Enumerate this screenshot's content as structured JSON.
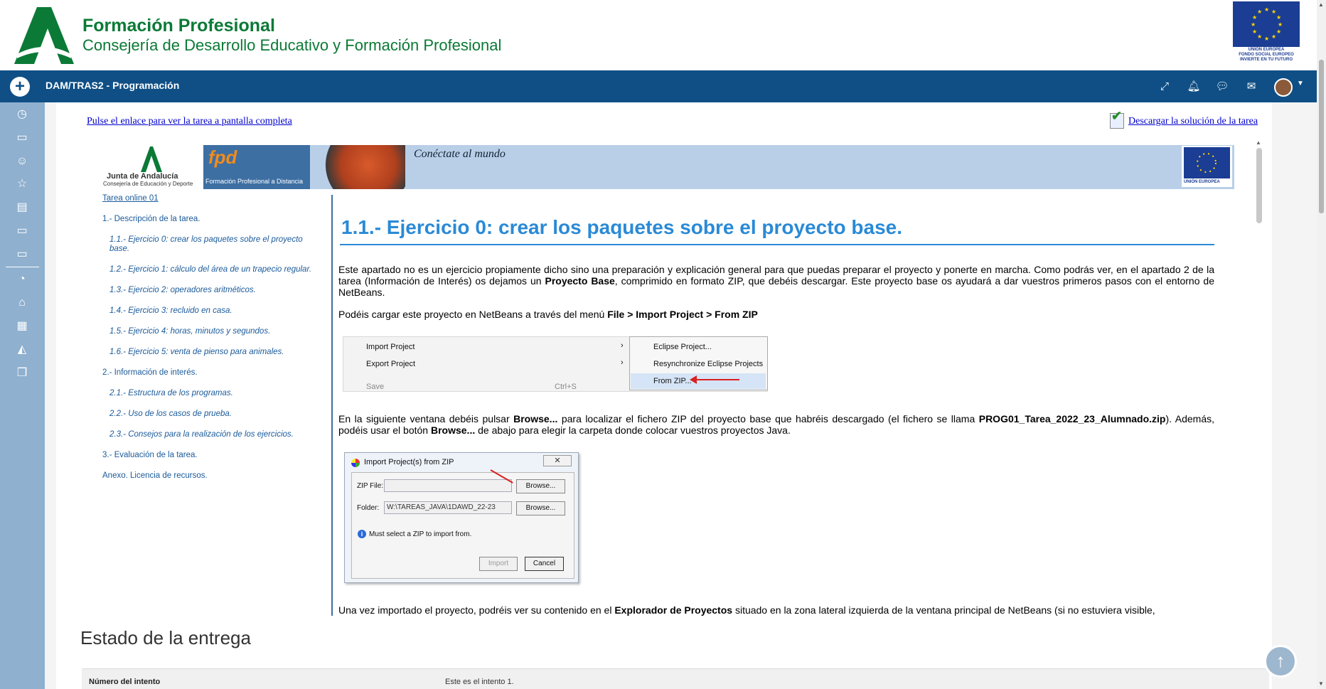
{
  "brand": {
    "title": "Formación Profesional",
    "subtitle": "Consejería de Desarrollo Educativo y Formación Profesional",
    "eu_caption_1": "UNIÓN EUROPEA",
    "eu_caption_2": "FONDO SOCIAL EUROPEO",
    "eu_caption_3": "INVIERTE EN TU FUTURO"
  },
  "navbar": {
    "course_title": "DAM/TRAS2 - Programación",
    "icons": [
      "expand-icon",
      "bell-icon",
      "chat-icon",
      "mail-icon"
    ]
  },
  "sidebar": {
    "icons": [
      "clock-icon",
      "folder-icon",
      "users-icon",
      "star-icon",
      "book-icon",
      "folder-icon",
      "folder-icon",
      "dashboard-icon",
      "home-icon",
      "calendar-icon",
      "graduation-icon",
      "files-icon"
    ]
  },
  "task": {
    "fullscreen_link": "Pulse el enlace para ver la tarea a pantalla completa",
    "download_link": "Descargar la solución de la tarea"
  },
  "banner": {
    "ja_name": "Junta de Andalucía",
    "ja_dept": "Consejería de Educación y Deporte",
    "fpd_logo": "fpd",
    "fpd_caption": "Formación Profesional a Distancia",
    "slogan": "Conéctate al mundo",
    "eu_caption": "UNIÓN EUROPEA"
  },
  "toc": {
    "title": "Tarea online 01",
    "items": [
      "1.- Descripción de la tarea.",
      "1.1.- Ejercicio 0: crear los paquetes sobre el proyecto",
      "base.",
      "1.2.- Ejercicio 1: cálculo del área de un trapecio regular.",
      "1.3.- Ejercicio 2: operadores aritméticos.",
      "1.4.- Ejercicio 3: recluido en casa.",
      "1.5.- Ejercicio 4: horas, minutos y segundos.",
      "1.6.- Ejercicio 5: venta de pienso para animales.",
      "2.- Información de interés.",
      "2.1.- Estructura de los programas.",
      "2.2.- Uso de los casos de prueba.",
      "2.3.- Consejos para la realización de los ejercicios.",
      "3.- Evaluación de la tarea.",
      "Anexo. Licencia de recursos."
    ]
  },
  "content": {
    "heading": "1.1.- Ejercicio 0: crear los paquetes sobre el proyecto base.",
    "p1_a": "Este apartado no es un ejercicio propiamente dicho sino una preparación y explicación general para que puedas preparar el proyecto y ponerte en marcha. Como podrás ver, en el apartado 2 de la tarea (Información de Interés) os dejamos un ",
    "p1_b": "Proyecto Base",
    "p1_c": ", comprimido en formato ZIP, que debéis descargar. Este proyecto base os ayudará a dar vuestros primeros pasos con el entorno de NetBeans.",
    "p2_a": "Podéis cargar este proyecto en NetBeans a través del menú ",
    "p2_b": "File > Import Project > From ZIP",
    "p3_a": "En la siguiente ventana debéis pulsar ",
    "p3_b": "Browse...",
    "p3_c": " para localizar el fichero ZIP del proyecto base que habréis descargado (el fichero se llama ",
    "p3_d": "PROG01_Tarea_2022_23_Alumnado.zip",
    "p3_e": "). Además, podéis usar el botón ",
    "p3_f": "Browse...",
    "p3_g": " de abajo para elegir la carpeta donde colocar vuestros proyectos Java.",
    "p4_a": "Una vez importado el proyecto, podréis ver su contenido en el ",
    "p4_b": "Explorador de Proyectos",
    "p4_c": " situado en la zona lateral izquierda de la ventana principal de NetBeans (si no estuviera visible,"
  },
  "menu_shot": {
    "import_project": "Import Project",
    "export_project": "Export Project",
    "save": "Save",
    "save_shortcut": "Ctrl+S",
    "eclipse_project": "Eclipse Project...",
    "resync": "Resynchronize Eclipse Projects",
    "from_zip": "From ZIP..."
  },
  "dialog_shot": {
    "title": "Import Project(s) from ZIP",
    "zip_label": "ZIP File:",
    "folder_label": "Folder:",
    "folder_value": "W:\\TAREAS_JAVA\\1DAWD_22-23",
    "browse": "Browse...",
    "info": "Must select a ZIP to import from.",
    "import_btn": "Import",
    "cancel_btn": "Cancel"
  },
  "estado": {
    "title": "Estado de la entrega",
    "row_label": "Número del intento",
    "row_value": "Este es el intento 1."
  }
}
